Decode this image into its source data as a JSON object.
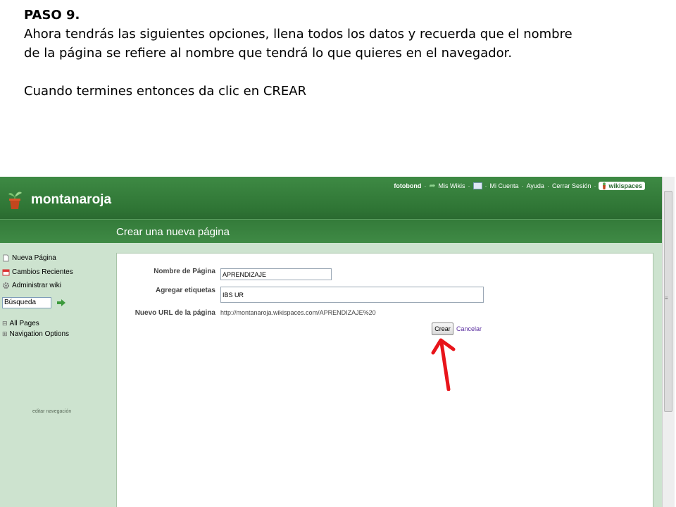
{
  "slide": {
    "step": "PASO 9.",
    "paragraph": "Ahora tendrás las siguientes opciones, llena todos los datos y recuerda que el nombre de la página se refiere al nombre que tendrá lo que quieres en el navegador.",
    "instruction": "Cuando termines entonces da clic en CREAR"
  },
  "header": {
    "site_name": "montanaroja",
    "page_heading": "Crear una nueva página",
    "nav": {
      "user": "fotobond",
      "my_wikis": "Mis Wikis",
      "my_account": "Mi Cuenta",
      "help": "Ayuda",
      "logout": "Cerrar Sesión",
      "brand": "wikispaces"
    }
  },
  "sidebar": {
    "new_page": "Nueva Página",
    "recent_changes": "Cambios Recientes",
    "manage_wiki": "Administrar wiki",
    "search_value": "Búsqueda",
    "all_pages": "All Pages",
    "navigation_options": "Navigation Options",
    "edit_navigation": "editar navegación"
  },
  "form": {
    "page_name_label": "Nombre de Página",
    "page_name_value": "APRENDIZAJE",
    "tags_label": "Agregar etiquetas",
    "tags_value": "IBS UR",
    "url_label": "Nuevo URL de la página",
    "url_value": "http://montanaroja.wikispaces.com/APRENDIZAJE%20",
    "create_button": "Crear",
    "cancel_link": "Cancelar"
  },
  "colors": {
    "header_green": "#2f7535",
    "sidebar_bg": "#cde3cf",
    "arrow_red": "#e8141a",
    "cancel_link": "#5b2fa0"
  }
}
